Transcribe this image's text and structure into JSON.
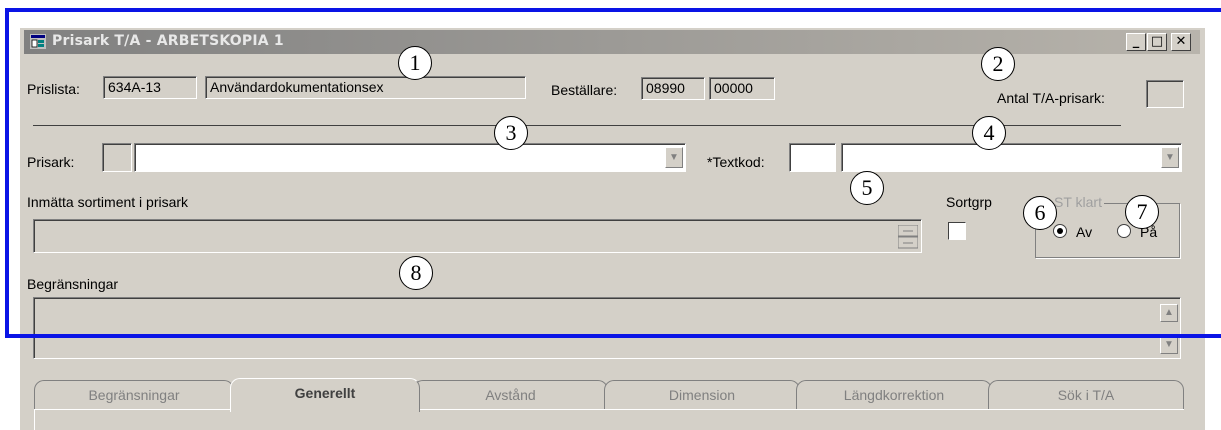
{
  "window": {
    "title": "Prisark T/A - ARBETSKOPIA 1",
    "min_label": "_",
    "max_label": "□",
    "close_label": "✕"
  },
  "header": {
    "prislista_label": "Prislista:",
    "prislista_code": "634A-13",
    "prislista_name": "Användardokumentationsex",
    "bestallare_label": "Beställare:",
    "bestallare_code1": "08990",
    "bestallare_code2": "00000",
    "antal_label": "Antal T/A-prisark:",
    "antal_value": ""
  },
  "prisark": {
    "label": "Prisark:",
    "code": "",
    "value": ""
  },
  "textkod": {
    "label": "*Textkod:",
    "code": "",
    "value": ""
  },
  "sortiment": {
    "label": "Inmätta sortiment i prisark",
    "value": ""
  },
  "sortgrp": {
    "label": "Sortgrp",
    "checked": false
  },
  "st_klart": {
    "label": "ST klart",
    "options": [
      "Av",
      "På"
    ],
    "selected": "Av"
  },
  "begransningar": {
    "label": "Begränsningar",
    "value": ""
  },
  "tabs": [
    {
      "label": "Begränsningar",
      "active": false
    },
    {
      "label": "Generellt",
      "active": true
    },
    {
      "label": "Avstånd",
      "active": false
    },
    {
      "label": "Dimension",
      "active": false
    },
    {
      "label": "Längdkorrektion",
      "active": false
    },
    {
      "label": "Sök i T/A",
      "active": false
    }
  ],
  "callouts": [
    "1",
    "2",
    "3",
    "4",
    "5",
    "6",
    "7",
    "8"
  ],
  "colors": {
    "highlight_border": "#0a14e6",
    "window_bg": "#d4d0c8",
    "titlebar_inactive": "#808080"
  },
  "icons": {
    "app": "price-sheet-icon",
    "dropdown": "chevron-down-icon",
    "spinner": "spinner-icon",
    "scroll_up": "scroll-up-icon",
    "scroll_down": "scroll-down-icon"
  }
}
